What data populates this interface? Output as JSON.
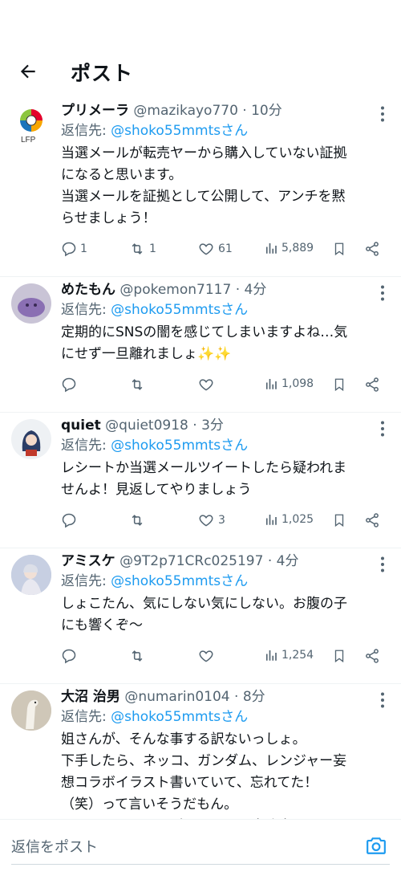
{
  "header": {
    "title": "ポスト",
    "back_icon": "arrow-left-icon"
  },
  "colors": {
    "accent": "#1d9bf0",
    "secondary_text": "#536471",
    "primary_text": "#0f1419"
  },
  "posts": [
    {
      "name": "プリメーラ",
      "handle": "@mazikayo770",
      "time": " · 10分",
      "reply_prefix": "返信先: ",
      "reply_target": "@shoko55mmtsさん",
      "text": "当選メールが転売ヤーから購入していない証拠\nになると思います。\n当選メールを証拠として公開して、アンチを黙\nらせましょう！",
      "replies": "1",
      "reposts": "1",
      "likes": "61",
      "views": "5,889"
    },
    {
      "name": "めたもん",
      "handle": "@pokemon7117",
      "time": " · 4分",
      "reply_prefix": "返信先: ",
      "reply_target": "@shoko55mmtsさん",
      "text": "定期的にSNSの闇を感じてしまいますよね…気\nにせず一旦離れましょ✨✨",
      "replies": "",
      "reposts": "",
      "likes": "",
      "views": "1,098"
    },
    {
      "name": "quiet",
      "handle": "@quiet0918",
      "time": " · 3分",
      "reply_prefix": "返信先: ",
      "reply_target": "@shoko55mmtsさん",
      "text": "レシートか当選メールツイートしたら疑われま\nせんよ！見返してやりましょう",
      "replies": "",
      "reposts": "",
      "likes": "3",
      "views": "1,025"
    },
    {
      "name": "アミスケ",
      "handle": "@9T2p71CRc025197",
      "time": " · 4分",
      "reply_prefix": "返信先: ",
      "reply_target": "@shoko55mmtsさん",
      "text": "しょこたん、気にしない気にしない。お腹の子\nにも響くぞ〜",
      "replies": "",
      "reposts": "",
      "likes": "",
      "views": "1,254"
    },
    {
      "name": "大沼 治男",
      "handle": "@numarin0104",
      "time": " · 8分",
      "reply_prefix": "返信先: ",
      "reply_target": "@shoko55mmtsさん",
      "text": "姐さんが、そんな事する訳ないっしょ。\n下手したら、ネッコ、ガンダム、レンジャー妄\n想コラボイラスト書いていて、忘れてた！\n（笑）って言いそうだもん。\nわかってるファンが居るから、大丈夫ですぜ、\n姐さん！",
      "replies": "",
      "reposts": "",
      "likes": "",
      "views": ""
    }
  ],
  "avatar1_logo_text": "LFP",
  "reply_bar": {
    "placeholder": "返信をポスト",
    "camera_icon": "camera-icon"
  }
}
